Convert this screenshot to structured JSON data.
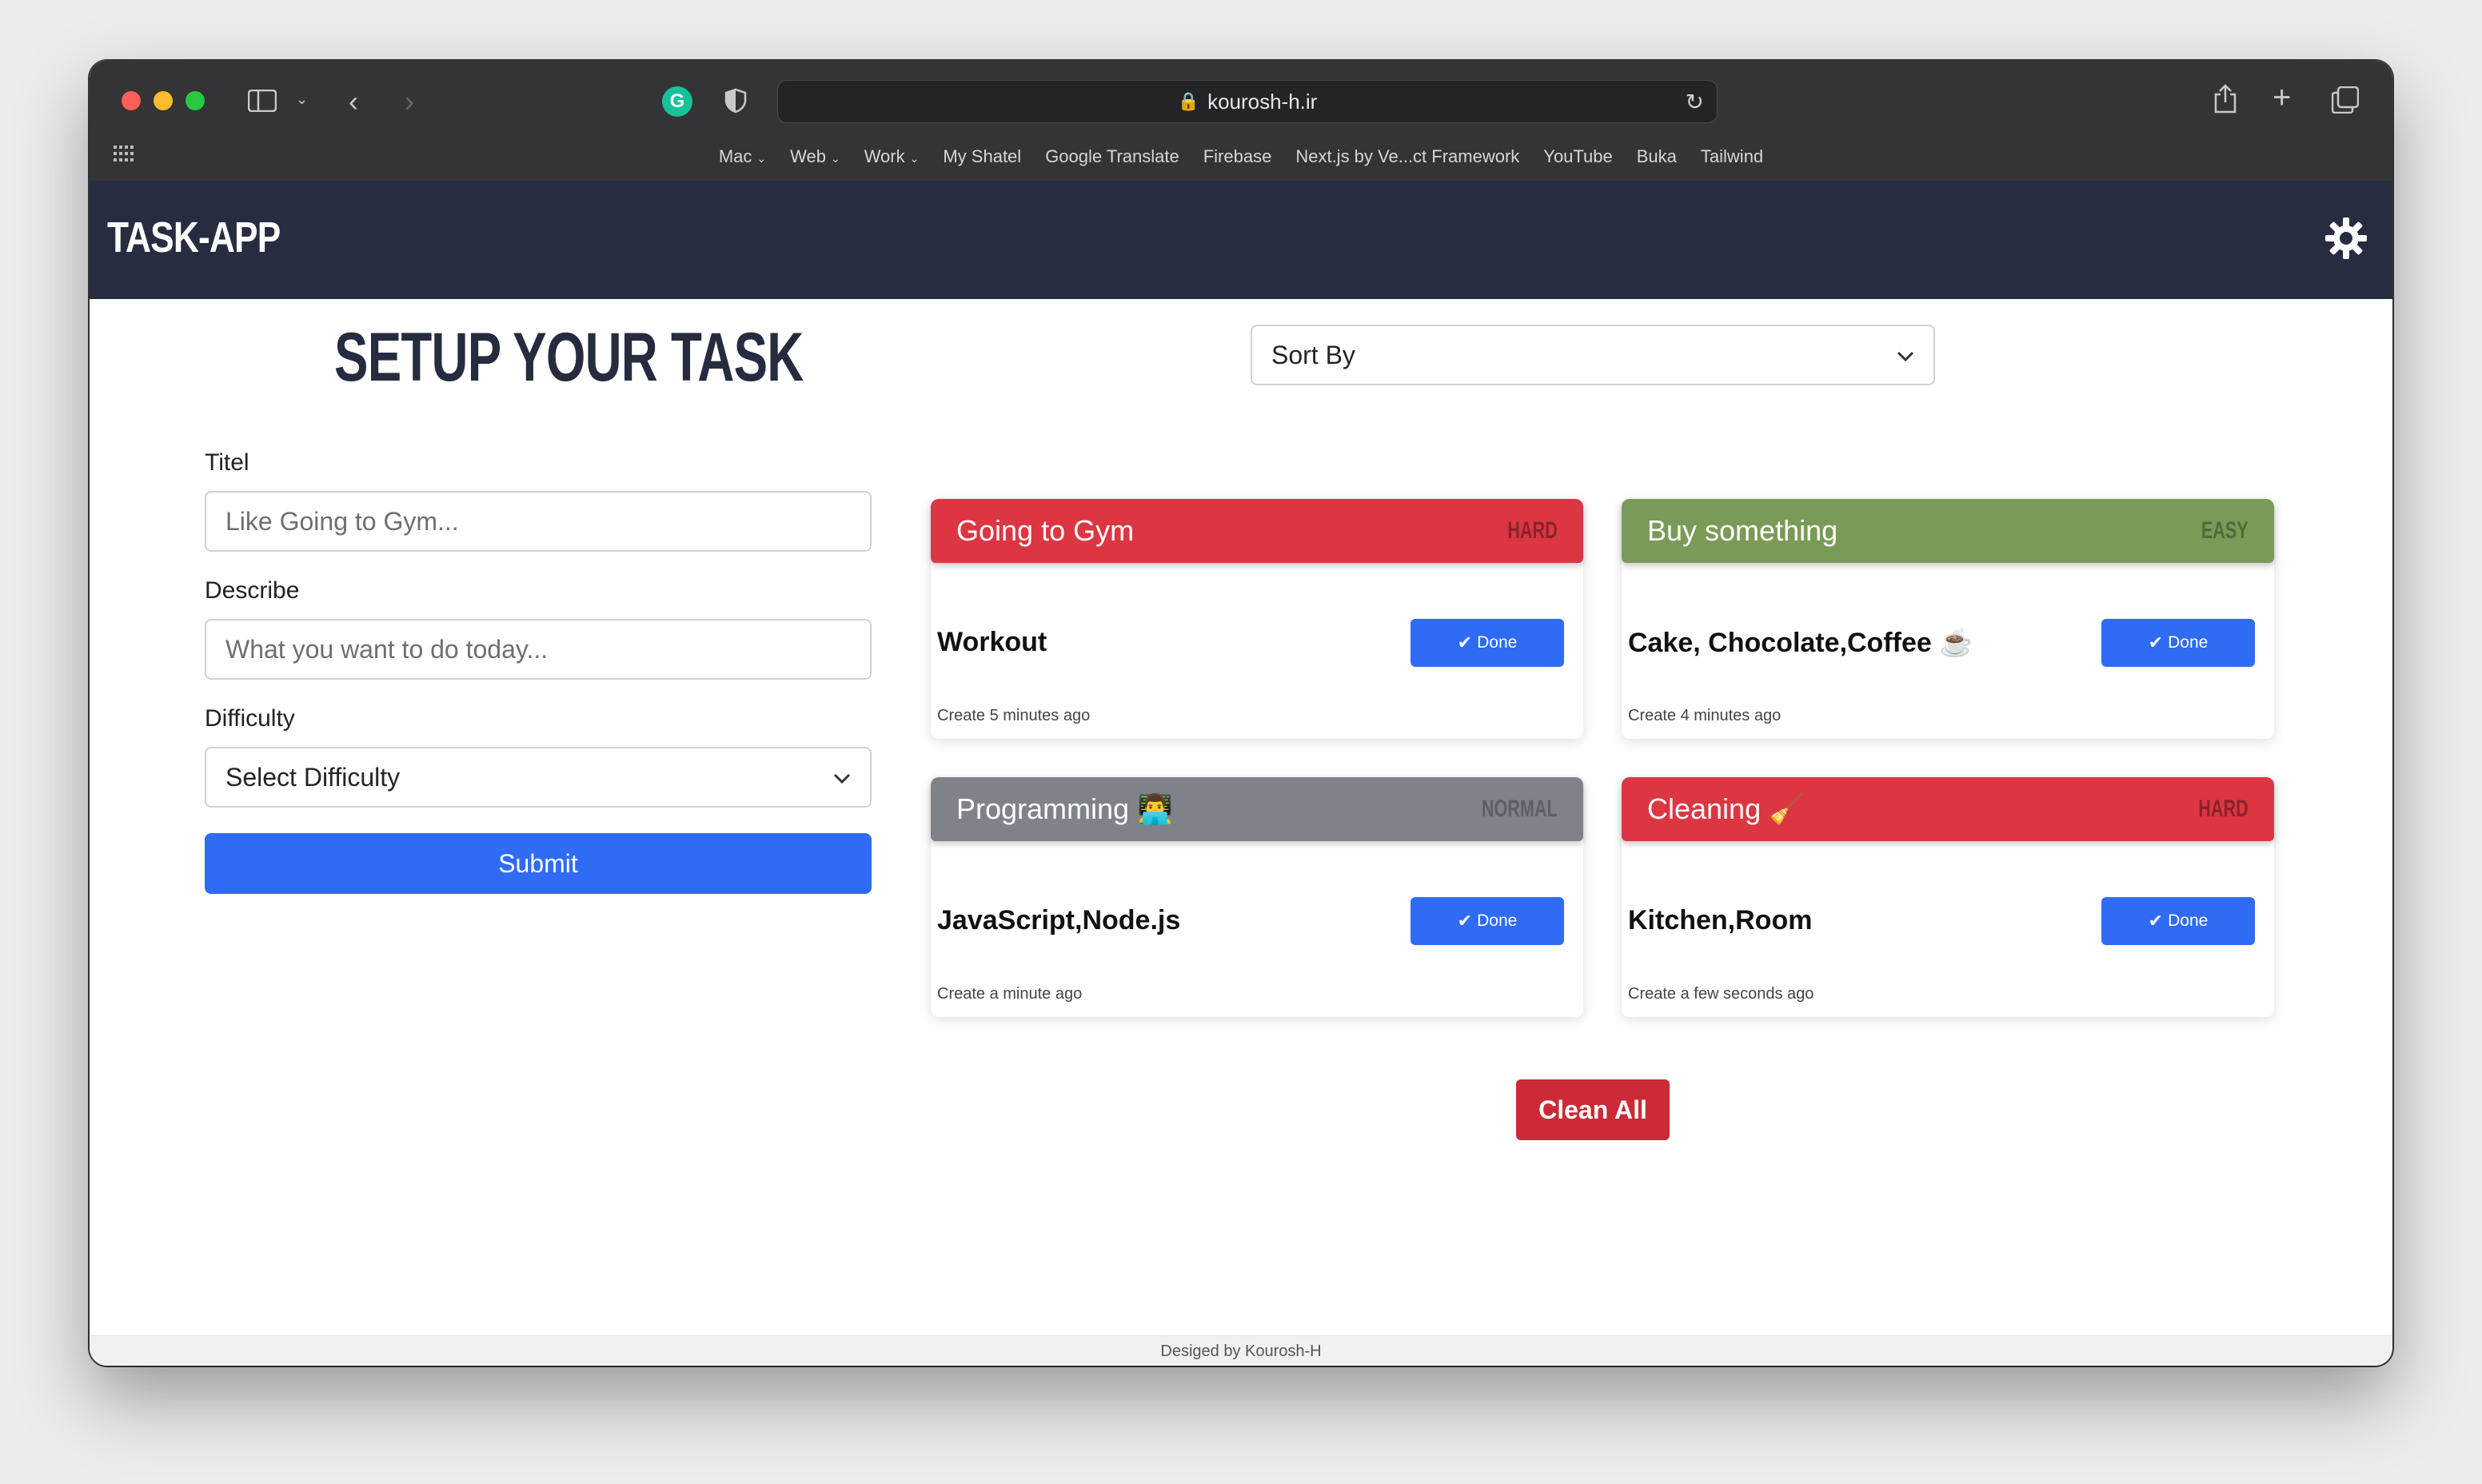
{
  "browser": {
    "url": "kourosh-h.ir",
    "bookmarks": [
      {
        "label": "Mac",
        "has_menu": true
      },
      {
        "label": "Web",
        "has_menu": true
      },
      {
        "label": "Work",
        "has_menu": true
      },
      {
        "label": "My Shatel",
        "has_menu": false
      },
      {
        "label": "Google Translate",
        "has_menu": false
      },
      {
        "label": "Firebase",
        "has_menu": false
      },
      {
        "label": "Next.js by Ve...ct Framework",
        "has_menu": false
      },
      {
        "label": "YouTube",
        "has_menu": false
      },
      {
        "label": "Buka",
        "has_menu": false
      },
      {
        "label": "Tailwind",
        "has_menu": false
      }
    ]
  },
  "navbar": {
    "brand": "TASK-APP",
    "theme_icon": "gear-icon"
  },
  "form": {
    "title": "SETUP YOUR TASK",
    "title_label": "Titel",
    "title_placeholder": "Like Going to Gym...",
    "describe_label": "Describe",
    "describe_placeholder": "What you want to do today...",
    "difficulty_label": "Difficulty",
    "difficulty_value": "Select Difficulty",
    "submit_label": "Submit"
  },
  "sort": {
    "value": "Sort By"
  },
  "tasks": [
    {
      "title": "Going to Gym",
      "difficulty": "HARD",
      "color": "#dc3642",
      "description": "Workout",
      "done_label": "Done",
      "time": "Create 5 minutes ago"
    },
    {
      "title": "Buy something",
      "difficulty": "EASY",
      "color": "#7a9a58",
      "description": "Cake, Chocolate,Coffee ☕",
      "done_label": "Done",
      "time": "Create 4 minutes ago"
    },
    {
      "title": "Programming 👨‍💻",
      "difficulty": "NORMAL",
      "color": "#7f8389",
      "description": "JavaScript,Node.js",
      "done_label": "Done",
      "time": "Create a minute ago"
    },
    {
      "title": "Cleaning 🧹",
      "difficulty": "HARD",
      "color": "#dc3642",
      "description": "Kitchen,Room",
      "done_label": "Done",
      "time": "Create a few seconds ago"
    }
  ],
  "actions": {
    "clean_all": "Clean All"
  },
  "footer": {
    "text": "Desiged by Kourosh-H"
  }
}
